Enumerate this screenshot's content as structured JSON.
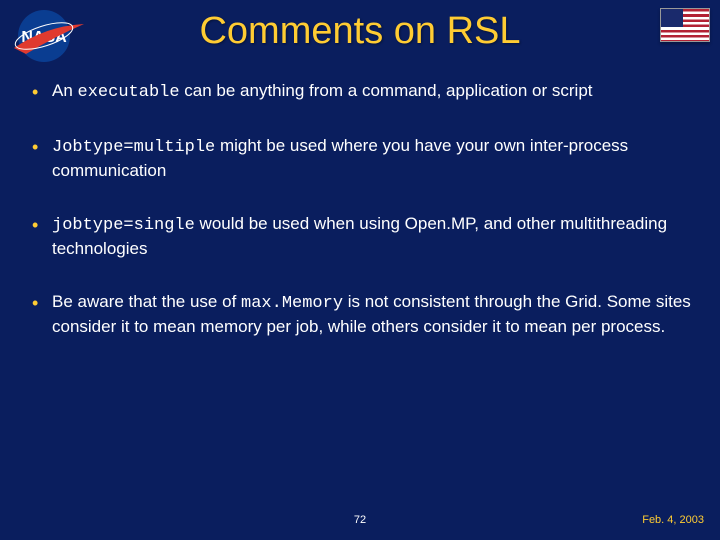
{
  "title": "Comments on RSL",
  "logos": {
    "left": "nasa-logo",
    "right": "us-flag"
  },
  "bullets": [
    {
      "pre": "An ",
      "code": "executable",
      "post": " can be anything from a command,  application or script"
    },
    {
      "pre": "",
      "code": "Jobtype=multiple",
      "post": " might be used where you have your own inter-process communication"
    },
    {
      "pre": "",
      "code": "jobtype=single",
      "post": " would be used when using Open.MP, and other multithreading technologies"
    },
    {
      "pre": "Be aware that the use of ",
      "code": "max.Memory",
      "post": " is not consistent through the Grid.  Some sites consider it to mean memory per job, while others consider it to mean per process."
    }
  ],
  "footer": {
    "page": "72",
    "date": "Feb. 4, 2003"
  }
}
